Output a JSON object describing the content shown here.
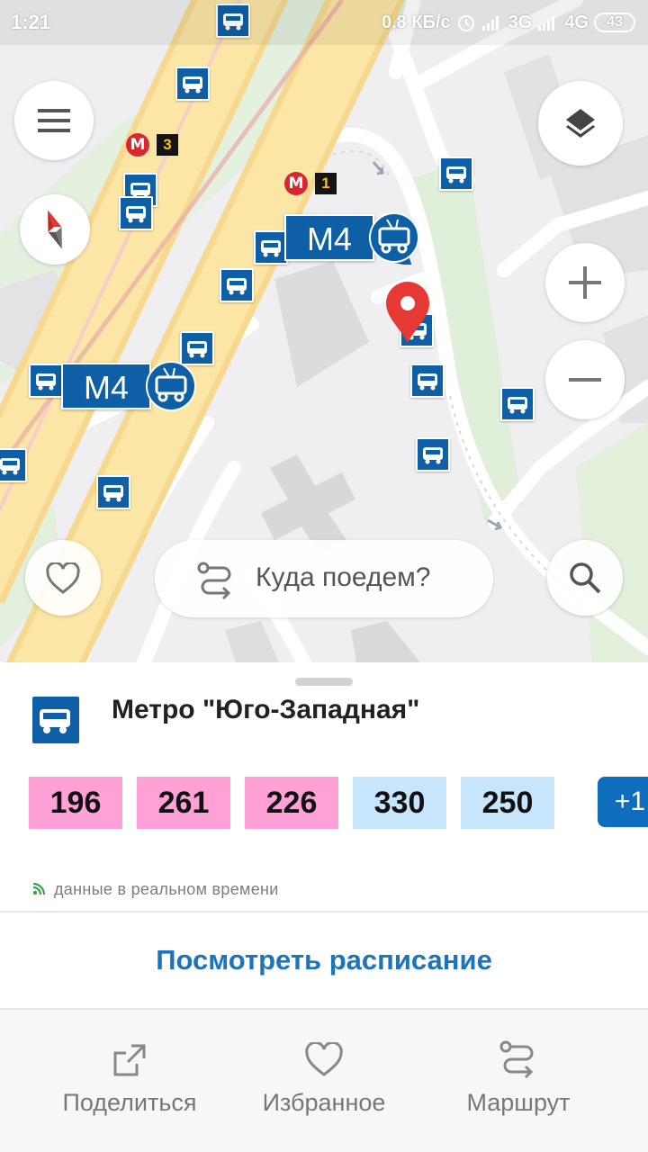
{
  "status_bar": {
    "time": "1:21",
    "net_speed": "0,8 КБ/с",
    "net1": "3G",
    "net2": "4G",
    "battery": "43"
  },
  "map": {
    "search_placeholder": "Куда поедем?",
    "route_tags": [
      "M4",
      "M4"
    ],
    "metro_lines": [
      "3",
      "1"
    ],
    "metro_logo": "М"
  },
  "stop": {
    "title": "Метро \"Юго-Западная\"",
    "routes": [
      {
        "number": "196",
        "kind": "bus",
        "color": "#ffa0d6"
      },
      {
        "number": "261",
        "kind": "bus",
        "color": "#ffa0d6"
      },
      {
        "number": "226",
        "kind": "bus",
        "color": "#ffa0d6"
      },
      {
        "number": "330",
        "kind": "trolleybus",
        "color": "#c7e6fd"
      },
      {
        "number": "250",
        "kind": "trolleybus",
        "color": "#c7e6fd"
      }
    ],
    "more_label": "+1",
    "realtime_label": "данные в реальном времени",
    "schedule_label": "Посмотреть расписание"
  },
  "actions": {
    "share": "Поделиться",
    "favorite": "Избранное",
    "route": "Маршрут"
  },
  "colors": {
    "accent": "#1c74bc",
    "transit_blue": "#0e5fa5",
    "pin_red": "#e53935",
    "metro_red": "#d9262f"
  },
  "icons": [
    "menu-icon",
    "compass-icon",
    "layers-icon",
    "zoom-in-icon",
    "zoom-out-icon",
    "heart-icon",
    "route-icon",
    "search-icon",
    "bus-stop-icon",
    "share-icon"
  ]
}
